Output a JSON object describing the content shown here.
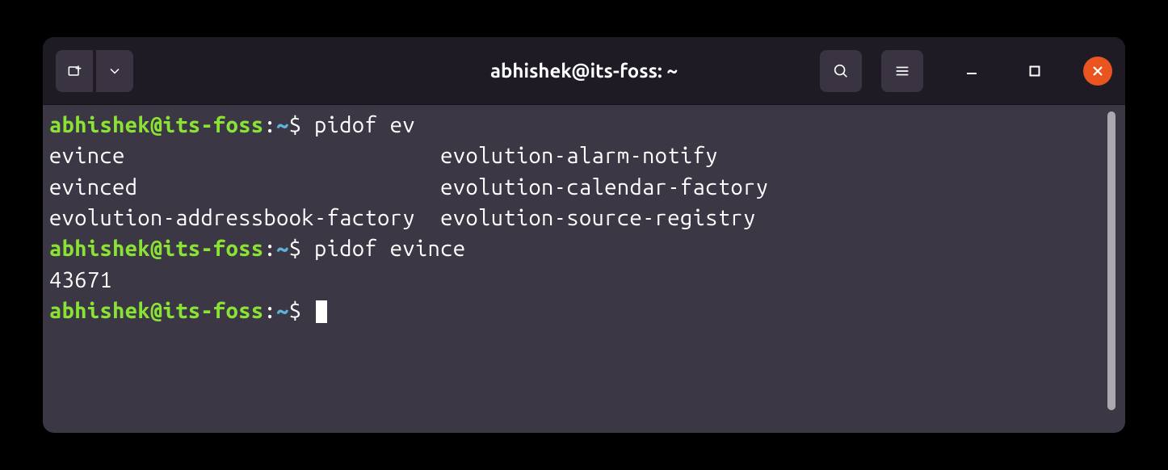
{
  "window": {
    "title": "abhishek@its-foss: ~"
  },
  "prompt": {
    "user_host": "abhishek@its-foss",
    "separator": ":",
    "cwd": "~",
    "symbol": "$"
  },
  "session": [
    {
      "type": "command",
      "command": "pidof ev"
    },
    {
      "type": "output_columns",
      "left": [
        "evince",
        "evinced",
        "evolution-addressbook-factory"
      ],
      "right": [
        "evolution-alarm-notify",
        "evolution-calendar-factory",
        "evolution-source-registry"
      ]
    },
    {
      "type": "command",
      "command": "pidof evince"
    },
    {
      "type": "output",
      "text": "43671"
    },
    {
      "type": "prompt_only"
    }
  ],
  "colors": {
    "user_host": "#8ae234",
    "path": "#5fb3d8",
    "text": "#ffffff",
    "terminal_bg": "#3b3745",
    "titlebar_bg": "#1f1b24",
    "close_btn": "#e95420"
  }
}
